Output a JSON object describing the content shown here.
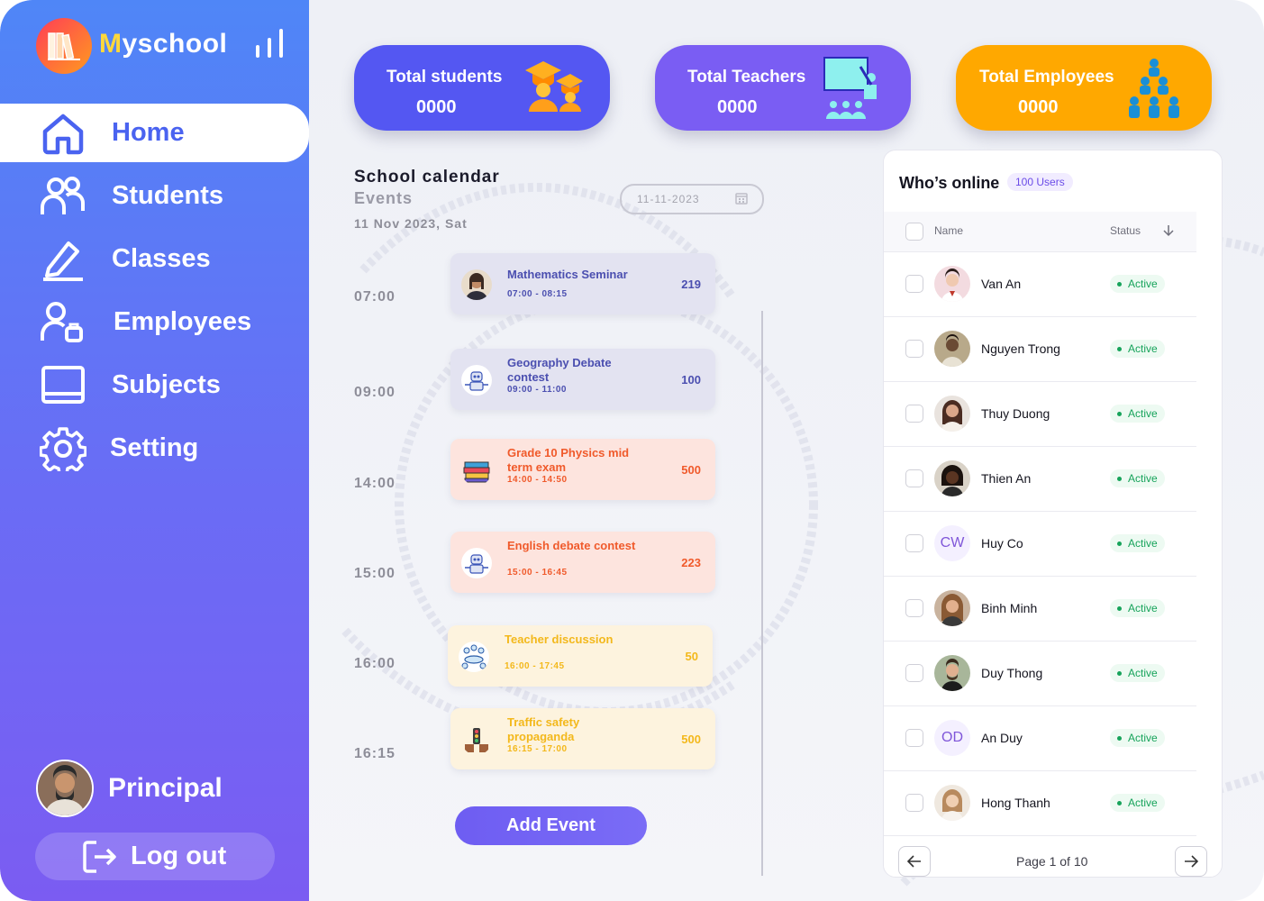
{
  "brand": {
    "prefix": "M",
    "rest": "yschool"
  },
  "nav": [
    {
      "label": "Home",
      "icon": "home-icon",
      "active": true
    },
    {
      "label": "Students",
      "icon": "students-icon"
    },
    {
      "label": "Classes",
      "icon": "classes-icon"
    },
    {
      "label": "Employees",
      "icon": "employees-icon"
    },
    {
      "label": "Subjects",
      "icon": "subjects-icon"
    },
    {
      "label": "Setting",
      "icon": "gear-icon"
    }
  ],
  "user": {
    "name": "Principal",
    "logout_label": "Log out"
  },
  "stats": [
    {
      "title": "Total students",
      "value": "0000",
      "color": "#5457f2"
    },
    {
      "title": "Total Teachers",
      "value": "0000",
      "color": "#7a5df3"
    },
    {
      "title": "Total Employees",
      "value": "0000",
      "color": "#ffa800"
    }
  ],
  "calendar": {
    "title": "School calendar",
    "subtitle": "Events",
    "date_text": "11 Nov 2023, Sat",
    "date_input": "11-11-2023",
    "events": [
      {
        "time": "07:00",
        "name": "Mathematics Seminar",
        "hours": "07:00 - 08:15",
        "count": "219",
        "theme": "blue"
      },
      {
        "time": "09:00",
        "name": "Geography Debate contest",
        "hours": "09:00 - 11:00",
        "count": "100",
        "theme": "blue"
      },
      {
        "time": "14:00",
        "name": "Grade 10 Physics mid term exam",
        "hours": "14:00 - 14:50",
        "count": "500",
        "theme": "pink"
      },
      {
        "time": "15:00",
        "name": "English debate contest",
        "hours": "15:00 - 16:45",
        "count": "223",
        "theme": "pink"
      },
      {
        "time": "16:00",
        "name": "Teacher discussion",
        "hours": "16:00 - 17:45",
        "count": "50",
        "theme": "yellow"
      },
      {
        "time": "16:15",
        "name": "Traffic safety propaganda",
        "hours": "16:15 - 17:00",
        "count": "500",
        "theme": "yellow"
      }
    ],
    "add_label": "Add Event"
  },
  "online": {
    "title": "Who’s online",
    "badge": "100 Users",
    "col_name": "Name",
    "col_status": "Status",
    "users": [
      {
        "name": "Van An",
        "status": "Active",
        "avatar": ""
      },
      {
        "name": "Nguyen Trong",
        "status": "Active",
        "avatar": ""
      },
      {
        "name": "Thuy Duong",
        "status": "Active",
        "avatar": ""
      },
      {
        "name": "Thien An",
        "status": "Active",
        "avatar": ""
      },
      {
        "name": "Huy Co",
        "status": "Active",
        "avatar": "CW"
      },
      {
        "name": "Binh Minh",
        "status": "Active",
        "avatar": ""
      },
      {
        "name": "Duy Thong",
        "status": "Active",
        "avatar": ""
      },
      {
        "name": "An Duy",
        "status": "Active",
        "avatar": "OD"
      },
      {
        "name": "Hong Thanh",
        "status": "Active",
        "avatar": ""
      }
    ],
    "page_label": "Page 1 of 10"
  }
}
